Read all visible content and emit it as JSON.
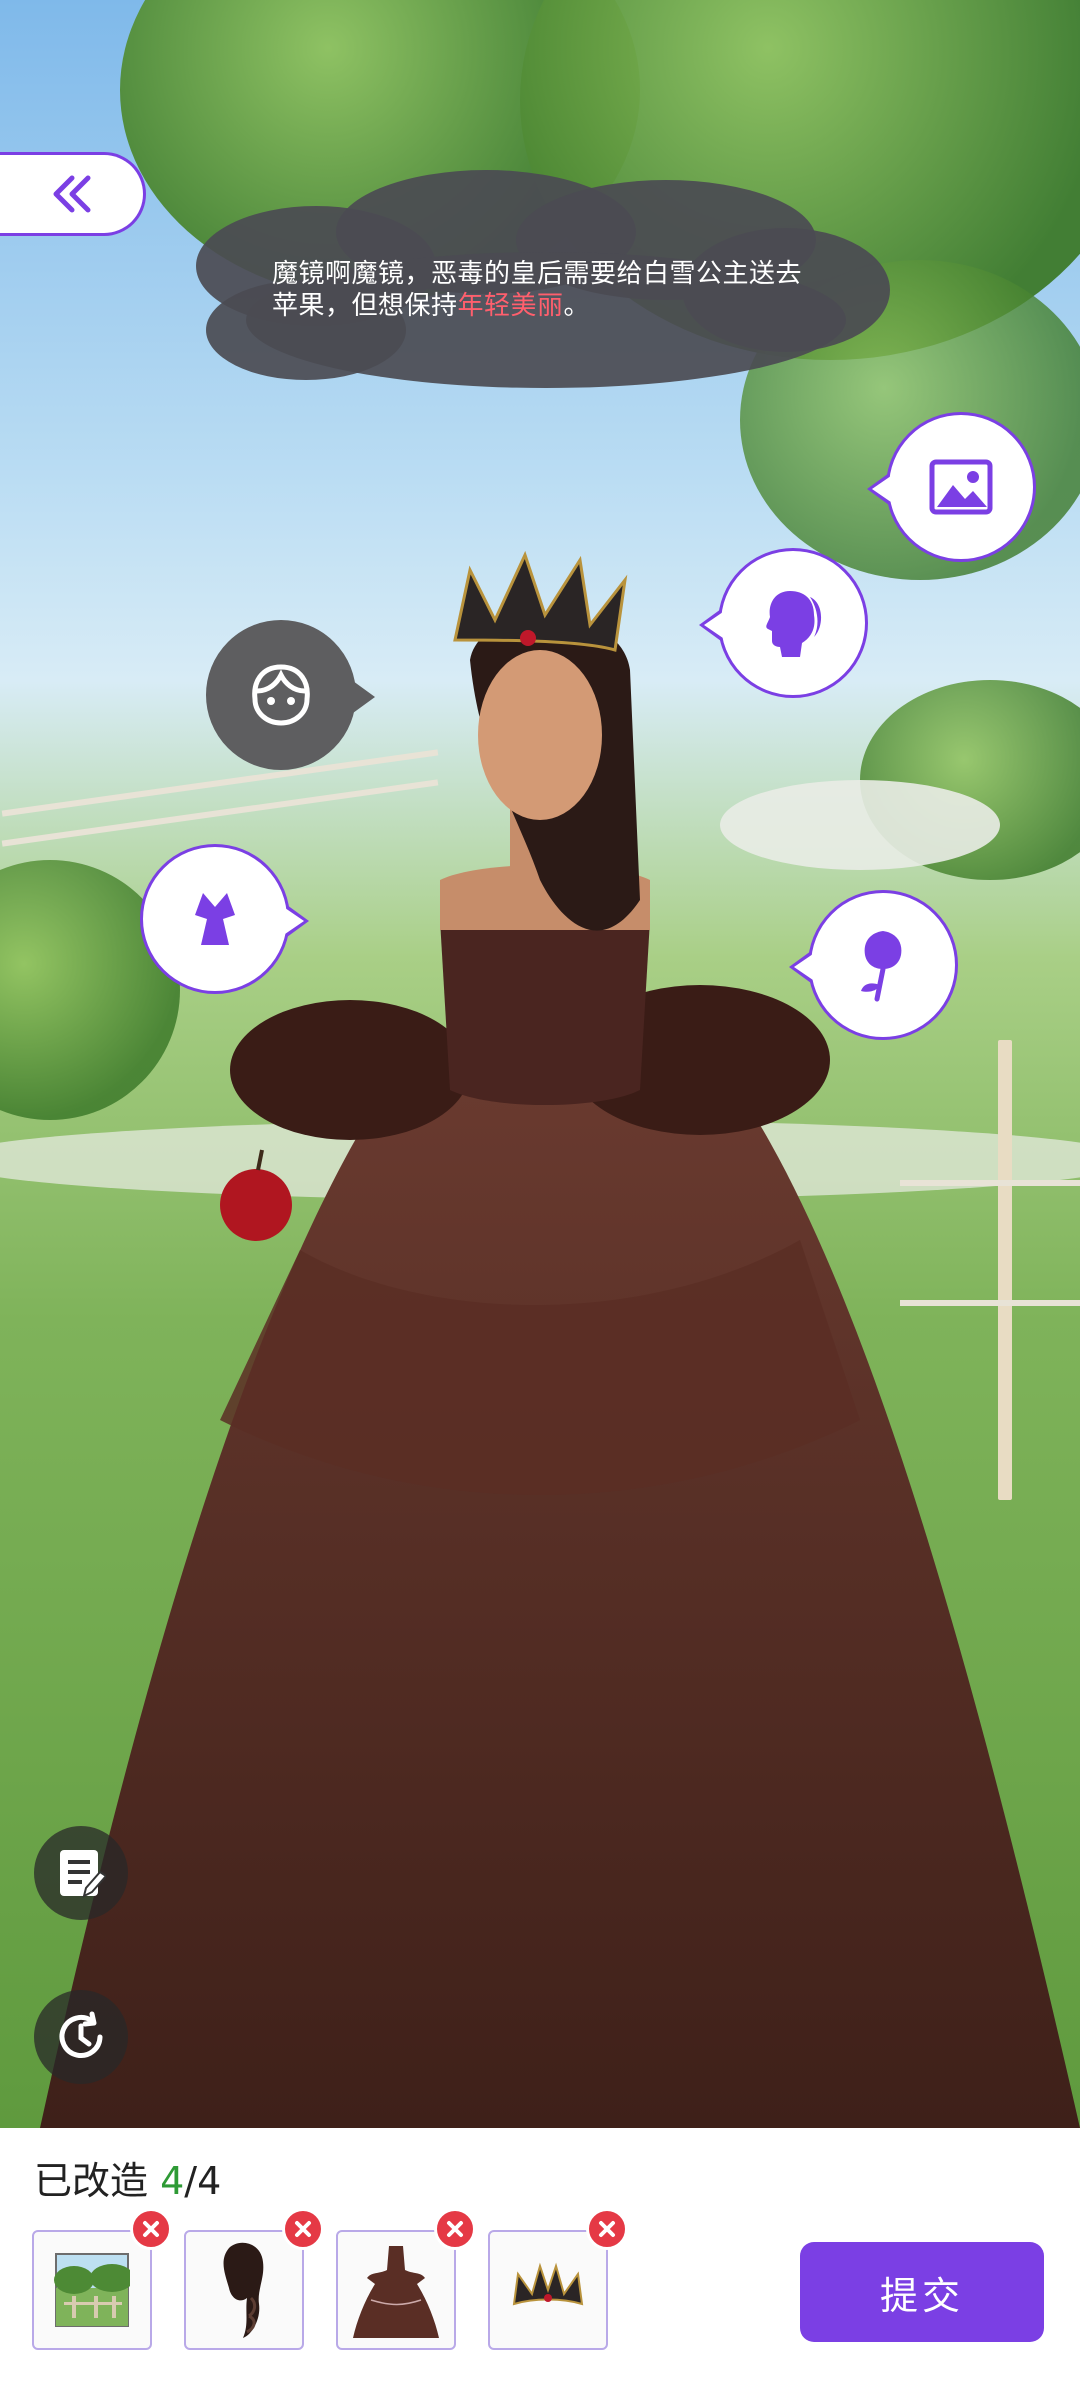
{
  "navigation": {
    "back_icon": "double-chevron-left-icon"
  },
  "narration": {
    "text_part1": "魔镜啊魔镜，恶毒的皇后需要给白雪公主送去苹果，但想保持",
    "highlight": "年轻美丽",
    "text_part2": "。",
    "highlight_color": "#ff5f6d"
  },
  "categories": [
    {
      "name": "background",
      "icon": "picture-icon"
    },
    {
      "name": "hair",
      "icon": "ponytail-profile-icon"
    },
    {
      "name": "face",
      "icon": "girl-face-icon"
    },
    {
      "name": "outfit",
      "icon": "dress-icon"
    },
    {
      "name": "accessory",
      "icon": "rose-icon"
    }
  ],
  "side_tools": [
    {
      "name": "notes",
      "icon": "notepad-icon"
    },
    {
      "name": "history",
      "icon": "clock-history-icon"
    }
  ],
  "progress": {
    "label": "已改造",
    "current": "4",
    "separator": "/",
    "total": "4",
    "current_color": "#2e9a35"
  },
  "selected_items": [
    {
      "name": "background",
      "icon": "meadow-background-thumbnail"
    },
    {
      "name": "hair",
      "icon": "braided-hair-thumbnail"
    },
    {
      "name": "dress",
      "icon": "brown-gown-thumbnail"
    },
    {
      "name": "crown",
      "icon": "dark-crown-thumbnail"
    }
  ],
  "submit": {
    "label": "提交"
  },
  "colors": {
    "accent": "#7b3fe4",
    "remove": "#e53945"
  }
}
